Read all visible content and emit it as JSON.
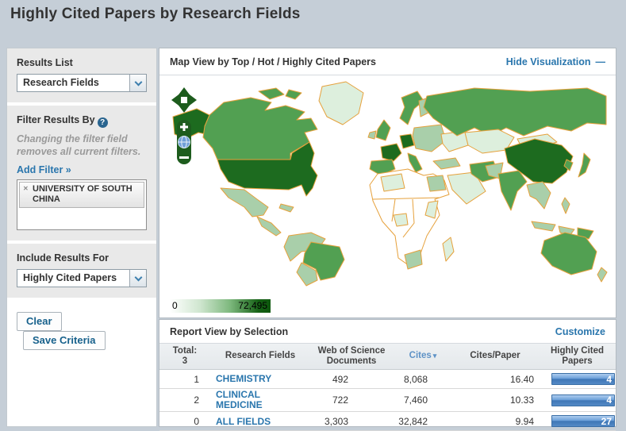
{
  "page": {
    "title": "Highly Cited Papers by Research Fields"
  },
  "icons": {
    "help": "?",
    "remove": "✕",
    "sort_down": "▾",
    "minus": "—"
  },
  "sidebar": {
    "results_list_label": "Results List",
    "results_list_value": "Research Fields",
    "filter_label": "Filter Results By",
    "filter_note": "Changing the filter field removes all current filters.",
    "add_filter_label": "Add Filter »",
    "filter_tag": "UNIVERSITY OF SOUTH CHINA",
    "include_label": "Include Results For",
    "include_value": "Highly Cited Papers",
    "clear_button": "Clear",
    "save_button": "Save Criteria"
  },
  "map": {
    "title": "Map View by Top / Hot / Highly Cited Papers",
    "hide_link": "Hide Visualization",
    "legend_min": "0",
    "legend_max": "72,495",
    "palette": {
      "highest": "#1d6b1f",
      "high": "#52a052",
      "medium": "#a9cfaa",
      "low": "#ddefdd",
      "none": "#ffffff",
      "border": "#e6a13c"
    }
  },
  "table": {
    "title": "Report View by Selection",
    "customize_link": "Customize",
    "total_label": "Total:",
    "total_value": "3",
    "col_field": "Research Fields",
    "col_docs": "Web of Science Documents",
    "col_cites": "Cites",
    "col_cpp": "Cites/Paper",
    "col_hcp": "Highly Cited Papers",
    "rows": [
      {
        "rank": "1",
        "field": "CHEMISTRY",
        "docs": "492",
        "cites": "8,068",
        "cpp": "16.40",
        "hcp": "4"
      },
      {
        "rank": "2",
        "field": "CLINICAL MEDICINE",
        "docs": "722",
        "cites": "7,460",
        "cpp": "10.33",
        "hcp": "4"
      },
      {
        "rank": "0",
        "field": "ALL FIELDS",
        "docs": "3,303",
        "cites": "32,842",
        "cpp": "9.94",
        "hcp": "27"
      }
    ]
  }
}
